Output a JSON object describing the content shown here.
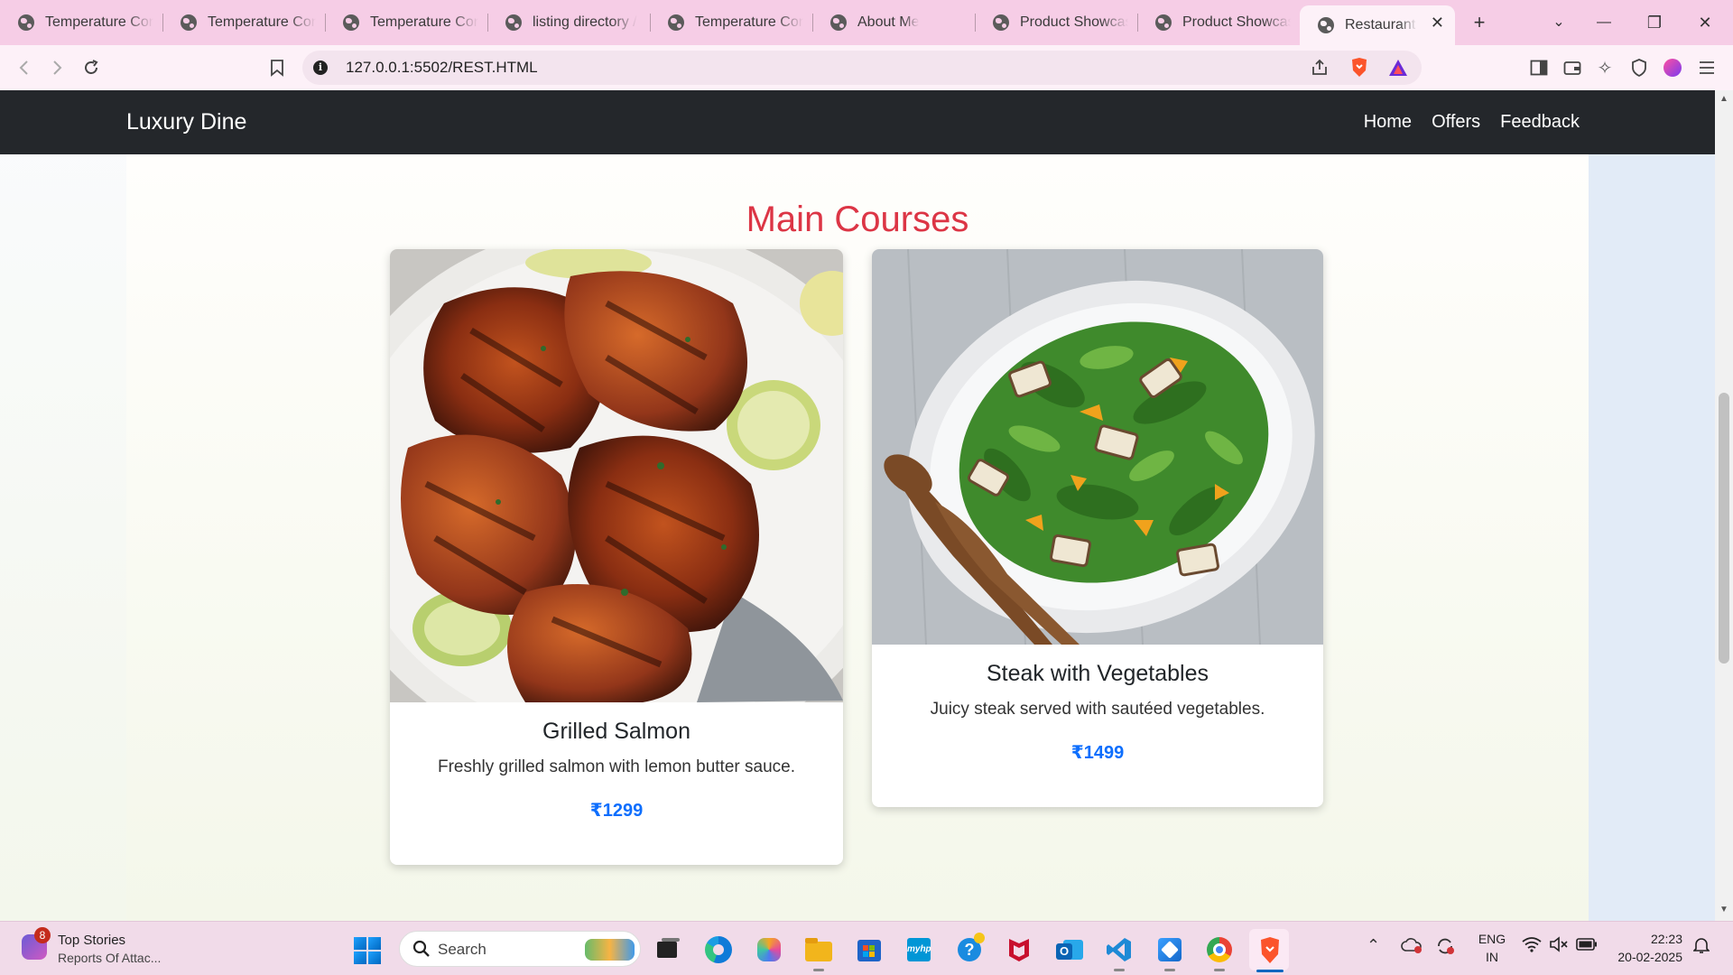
{
  "browser": {
    "tabs": [
      {
        "label": "Temperature Con"
      },
      {
        "label": "Temperature Con"
      },
      {
        "label": "Temperature Con"
      },
      {
        "label": "listing directory /"
      },
      {
        "label": "Temperature Con"
      },
      {
        "label": "About Me"
      },
      {
        "label": "Product Showcas"
      },
      {
        "label": "Product Showcas"
      },
      {
        "label": "Restaurant M"
      }
    ],
    "new_tab": "+",
    "address": "127.0.0.1:5502/REST.HTML"
  },
  "page": {
    "brand": "Luxury Dine",
    "nav": [
      "Home",
      "Offers",
      "Feedback"
    ],
    "section_title": "Main Courses",
    "cards": [
      {
        "title": "Grilled Salmon",
        "description": "Freshly grilled salmon with lemon butter sauce.",
        "price": "₹1299"
      },
      {
        "title": "Steak with Vegetables",
        "description": "Juicy steak served with sautéed vegetables.",
        "price": "₹1499"
      }
    ]
  },
  "taskbar": {
    "news_badge": "8",
    "news_title": "Top Stories",
    "news_subtitle": "Reports Of Attac...",
    "search_placeholder": "Search",
    "lang_line1": "ENG",
    "lang_line2": "IN",
    "time": "22:23",
    "date": "20-02-2025"
  },
  "colors": {
    "tab_strip": "#f6cde6",
    "navbar": "#24272b",
    "section_title": "#dc3545",
    "price": "#0d6efd"
  }
}
